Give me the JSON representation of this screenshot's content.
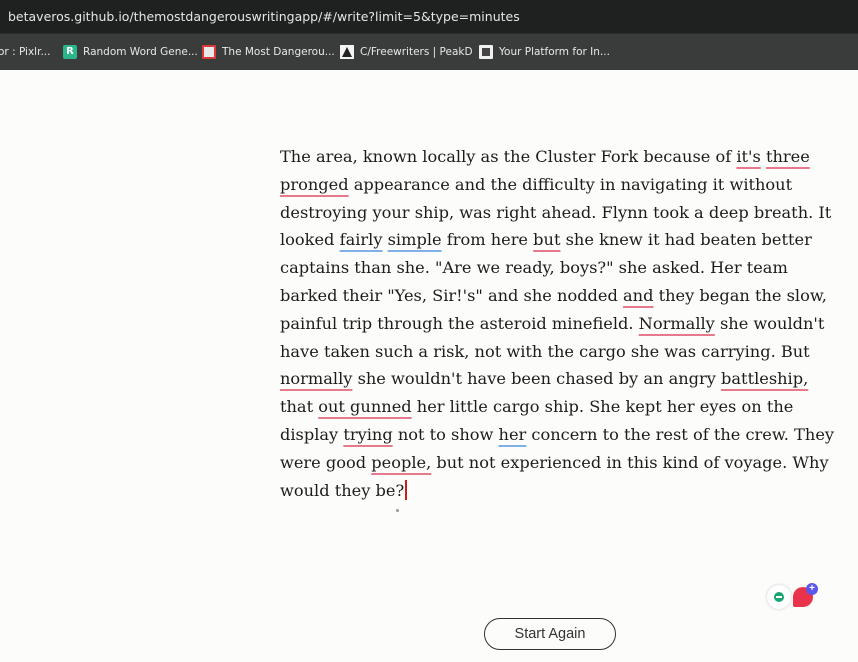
{
  "browser": {
    "url": "betaveros.github.io/themostdangerouswritingapp/#/write?limit=5&type=minutes"
  },
  "bookmarks": [
    {
      "label": "or : Pixlr...",
      "icon": "none"
    },
    {
      "label": "Random Word Gene...",
      "icon": "r-logo-icon"
    },
    {
      "label": "The Most Dangerou...",
      "icon": "red-square-icon"
    },
    {
      "label": "C/Freewriters | PeakD",
      "icon": "peak-icon"
    },
    {
      "label": "Your Platform for In...",
      "icon": "b-logo-icon"
    }
  ],
  "writing": {
    "lines": [
      [
        "The area, known locally as the Cluster Fork because of ",
        "it's",
        " ",
        "three",
        ""
      ],
      [
        "pronged",
        " appearance and the difficulty in navigating it without"
      ],
      [
        "destroying your ship, was right ahead. Flynn took a deep breath. It"
      ],
      [
        "looked ",
        "fairly",
        " ",
        "simple",
        " from here ",
        "but",
        " she knew it had beaten better"
      ],
      [
        "captains than she. \"Are we ready, boys?\" she asked. Her team"
      ],
      [
        "barked their \"Yes, Sir!'s\" and she nodded ",
        "and",
        " they began the slow,"
      ],
      [
        "painful trip through the asteroid minefield. ",
        "Normally",
        " she wouldn't"
      ],
      [
        "have taken such a risk, not with the cargo she was carrying. But"
      ],
      [
        "normally",
        " she wouldn't have been chased by an angry ",
        "battleship,",
        ""
      ],
      [
        "that ",
        "out gunned",
        " her little cargo ship. She kept her eyes on the"
      ],
      [
        "display ",
        "trying",
        " not to show ",
        "her",
        " concern to the rest of the crew. They"
      ],
      [
        "were good ",
        "people,",
        " but not experienced in this kind of voyage. Why"
      ],
      [
        "would they be?"
      ]
    ]
  },
  "actions": {
    "start_again": "Start Again"
  },
  "colors": {
    "spell_underline": "#e57a8d",
    "grammar_underline": "#7fb0e8",
    "caret": "#d11a1a"
  }
}
